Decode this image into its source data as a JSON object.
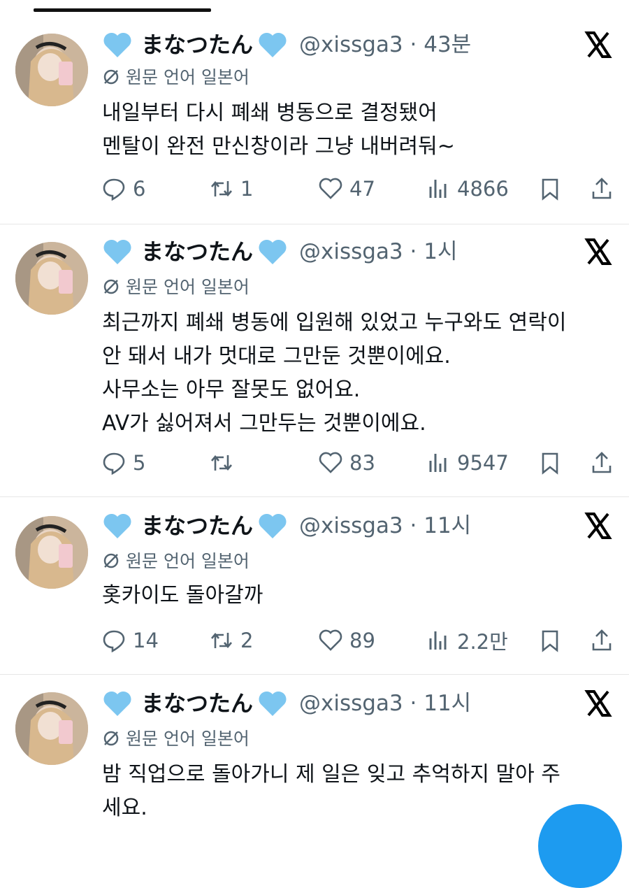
{
  "colors": {
    "heart": "#7cc6f0",
    "text": "#0f1419",
    "muted": "#536471",
    "fab": "#1d9bf0"
  },
  "tweets": [
    {
      "name": "まなつたん",
      "handle_time": "@xissga3 · 43분",
      "translate": "원문 언어 일본어",
      "lines": [
        "내일부터 다시 폐쇄 병동으로 결정됐어",
        "멘탈이 완전 만신창이라 그냥 내버려둬~"
      ],
      "replies": "6",
      "reposts": "1",
      "likes": "47",
      "views": "4866"
    },
    {
      "name": "まなつたん",
      "handle_time": "@xissga3 · 1시",
      "translate": "원문 언어 일본어",
      "lines": [
        "최근까지 폐쇄 병동에 입원해 있었고 누구와도 연락이",
        "안 돼서 내가 멋대로 그만둔 것뿐이에요.",
        "사무소는 아무 잘못도 없어요.",
        "AV가 싫어져서 그만두는 것뿐이에요."
      ],
      "replies": "5",
      "reposts": "",
      "likes": "83",
      "views": "9547"
    },
    {
      "name": "まなつたん",
      "handle_time": "@xissga3 · 11시",
      "translate": "원문 언어 일본어",
      "lines": [
        "홋카이도 돌아갈까"
      ],
      "replies": "14",
      "reposts": "2",
      "likes": "89",
      "views": "2.2만"
    },
    {
      "name": "まなつたん",
      "handle_time": "@xissga3 · 11시",
      "translate": "원문 언어 일본어",
      "lines": [
        "밤 직업으로 돌아가니 제 일은 잊고 추억하지 말아 주",
        "세요."
      ]
    }
  ]
}
